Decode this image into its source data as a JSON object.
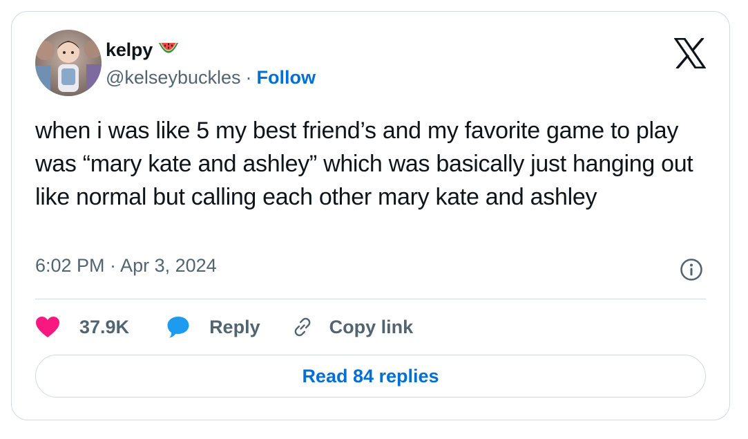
{
  "author": {
    "display_name": "kelpy",
    "emoji_icon": "watermelon-icon",
    "handle": "@kelseybuckles",
    "separator": "·",
    "follow_label": "Follow"
  },
  "brand": {
    "logo_icon": "x-logo-icon"
  },
  "tweet": {
    "text": "when i was like 5 my best friend’s and my favorite game to play was “mary kate and ashley” which was basically just hanging out like normal but calling each other mary kate and ashley",
    "timestamp": "6:02 PM · Apr 3, 2024"
  },
  "actions": {
    "like_count": "37.9K",
    "reply_label": "Reply",
    "copy_link_label": "Copy link"
  },
  "footer": {
    "read_replies_label": "Read 84 replies"
  },
  "colors": {
    "text": "#0f1419",
    "secondary_text": "#536471",
    "link_blue": "#006fd6",
    "like_pink": "#f91880",
    "reply_blue": "#1d9bf0",
    "border": "#cfd9de"
  }
}
